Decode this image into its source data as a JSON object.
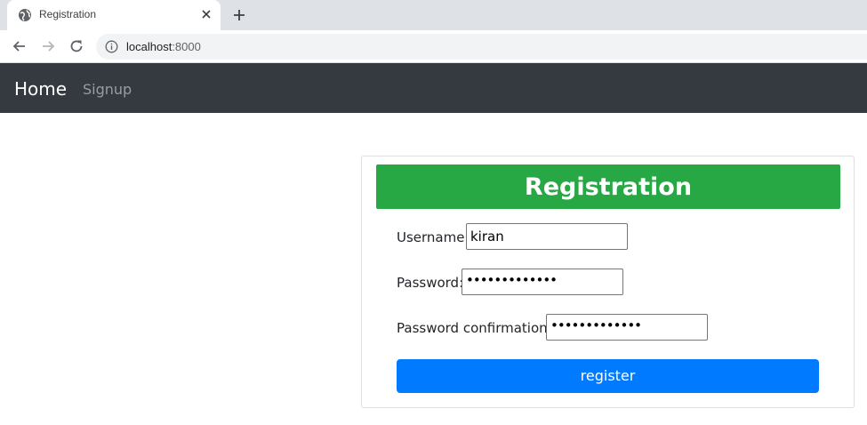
{
  "browser": {
    "tab_title": "Registration",
    "url_host": "localhost",
    "url_port": ":8000",
    "icons": {
      "favicon": "globe-icon",
      "close": "close-icon",
      "new_tab": "plus-icon",
      "back": "arrow-left-icon",
      "forward": "arrow-right-icon",
      "reload": "reload-icon",
      "site_info": "info-icon"
    }
  },
  "navbar": {
    "brand": "Home",
    "links": [
      "Signup"
    ],
    "background": "#343a40"
  },
  "form": {
    "title": "Registration",
    "header_color": "#28a745",
    "fields": [
      {
        "label": "Username:",
        "value": "kiran",
        "type": "text"
      },
      {
        "label": "Password:",
        "value": "•••••••••••••",
        "type": "password"
      },
      {
        "label": "Password confirmation:",
        "value": "•••••••••••••",
        "type": "password"
      }
    ],
    "submit_label": "register",
    "submit_color": "#007bff"
  }
}
